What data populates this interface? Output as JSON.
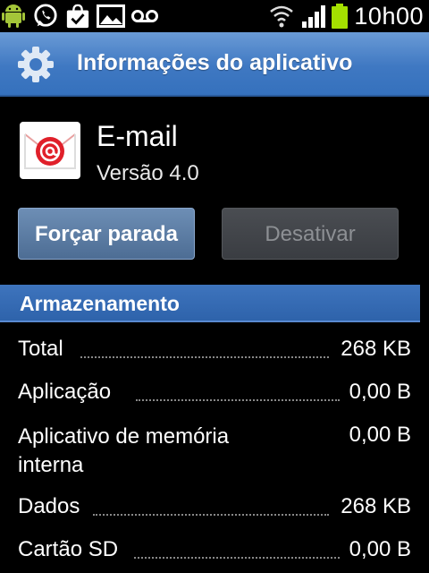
{
  "status_bar": {
    "time": "10h00",
    "icons": [
      "android-icon",
      "whatsapp-icon",
      "bag-check-icon",
      "gallery-icon",
      "voicemail-icon",
      "wifi-icon",
      "signal-icon",
      "battery-icon"
    ]
  },
  "title_bar": {
    "title": "Informações do aplicativo",
    "icon": "settings-gear-icon"
  },
  "app": {
    "name": "E-mail",
    "version": "Versão 4.0",
    "icon": "email-icon"
  },
  "buttons": {
    "force_stop": "Forçar parada",
    "disable": "Desativar"
  },
  "storage": {
    "section_title": "Armazenamento",
    "rows": [
      {
        "label": "Total",
        "value": "268 KB"
      },
      {
        "label": "Aplicação",
        "value": "0,00 B"
      },
      {
        "label": "Aplicativo de memória interna",
        "value": "0,00 B"
      },
      {
        "label": "Dados",
        "value": "268 KB"
      },
      {
        "label": "Cartão SD",
        "value": "0,00 B"
      }
    ]
  },
  "colors": {
    "accent": "#3f78c2",
    "background": "#000000",
    "battery": "#a4e000"
  }
}
